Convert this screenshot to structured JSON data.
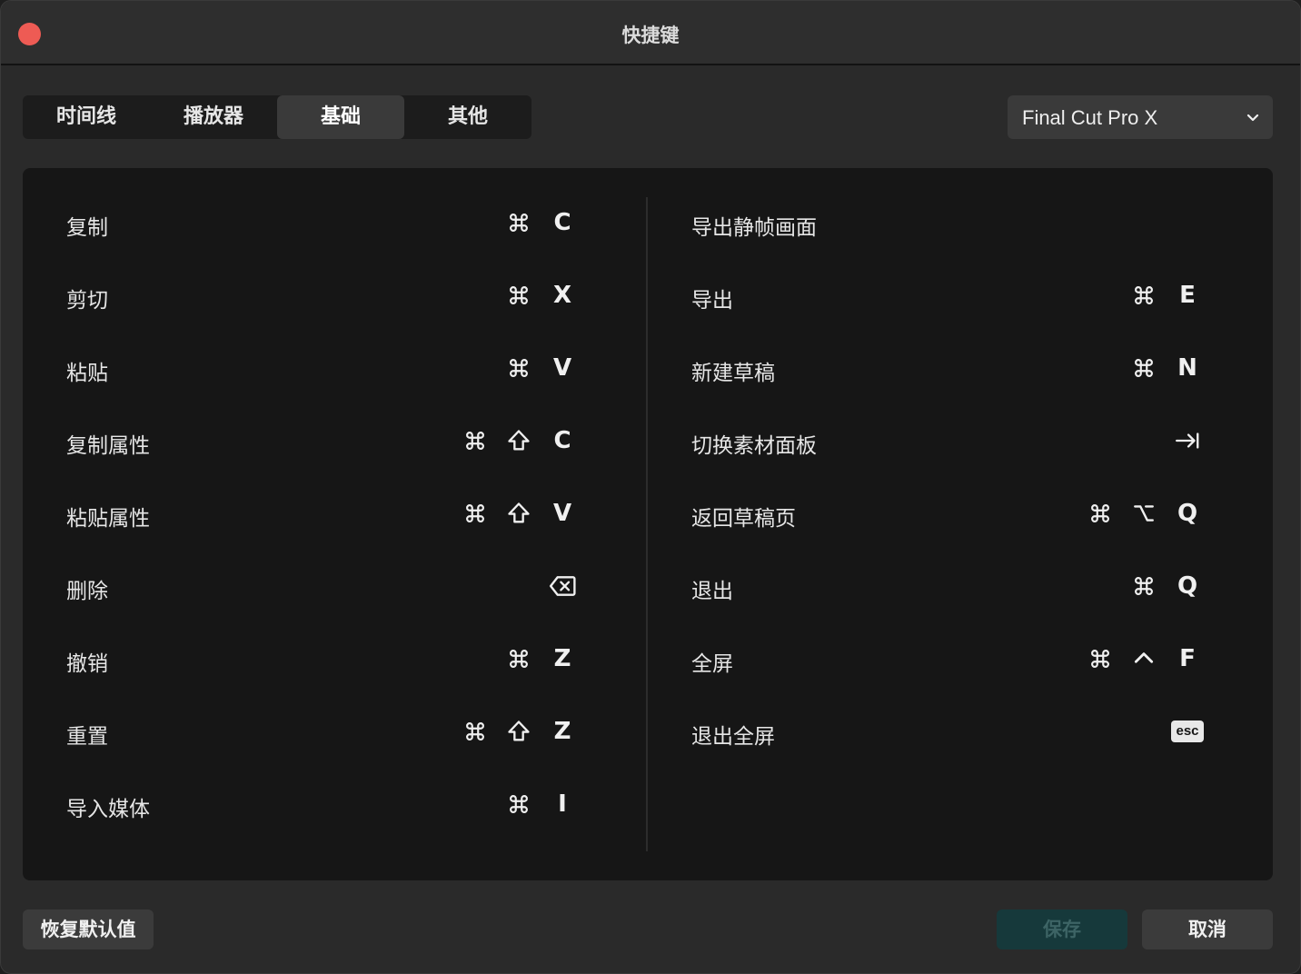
{
  "window": {
    "title": "快捷键"
  },
  "tabs": [
    {
      "label": "时间线",
      "active": false
    },
    {
      "label": "播放器",
      "active": false
    },
    {
      "label": "基础",
      "active": true
    },
    {
      "label": "其他",
      "active": false
    }
  ],
  "preset": {
    "value": "Final Cut Pro X"
  },
  "shortcuts": {
    "left": [
      {
        "label": "复制",
        "keys": [
          "cmd",
          "C"
        ]
      },
      {
        "label": "剪切",
        "keys": [
          "cmd",
          "X"
        ]
      },
      {
        "label": "粘贴",
        "keys": [
          "cmd",
          "V"
        ]
      },
      {
        "label": "复制属性",
        "keys": [
          "cmd",
          "shift",
          "C"
        ]
      },
      {
        "label": "粘贴属性",
        "keys": [
          "cmd",
          "shift",
          "V"
        ]
      },
      {
        "label": "删除",
        "keys": [
          "delete"
        ]
      },
      {
        "label": "撤销",
        "keys": [
          "cmd",
          "Z"
        ]
      },
      {
        "label": "重置",
        "keys": [
          "cmd",
          "shift",
          "Z"
        ]
      },
      {
        "label": "导入媒体",
        "keys": [
          "cmd",
          "I"
        ]
      }
    ],
    "right": [
      {
        "label": "导出静帧画面",
        "keys": []
      },
      {
        "label": "导出",
        "keys": [
          "cmd",
          "E"
        ]
      },
      {
        "label": "新建草稿",
        "keys": [
          "cmd",
          "N"
        ]
      },
      {
        "label": "切换素材面板",
        "keys": [
          "tab"
        ]
      },
      {
        "label": "返回草稿页",
        "keys": [
          "cmd",
          "option",
          "Q"
        ]
      },
      {
        "label": "退出",
        "keys": [
          "cmd",
          "Q"
        ]
      },
      {
        "label": "全屏",
        "keys": [
          "cmd",
          "control",
          "F"
        ]
      },
      {
        "label": "退出全屏",
        "keys": [
          "esc"
        ]
      }
    ]
  },
  "key_text": {
    "esc": "esc"
  },
  "footer": {
    "reset_label": "恢复默认值",
    "save_label": "保存",
    "cancel_label": "取消"
  },
  "colors": {
    "close": "#ee5b54",
    "save_bg": "#16393b",
    "save_text": "#3d6465"
  }
}
